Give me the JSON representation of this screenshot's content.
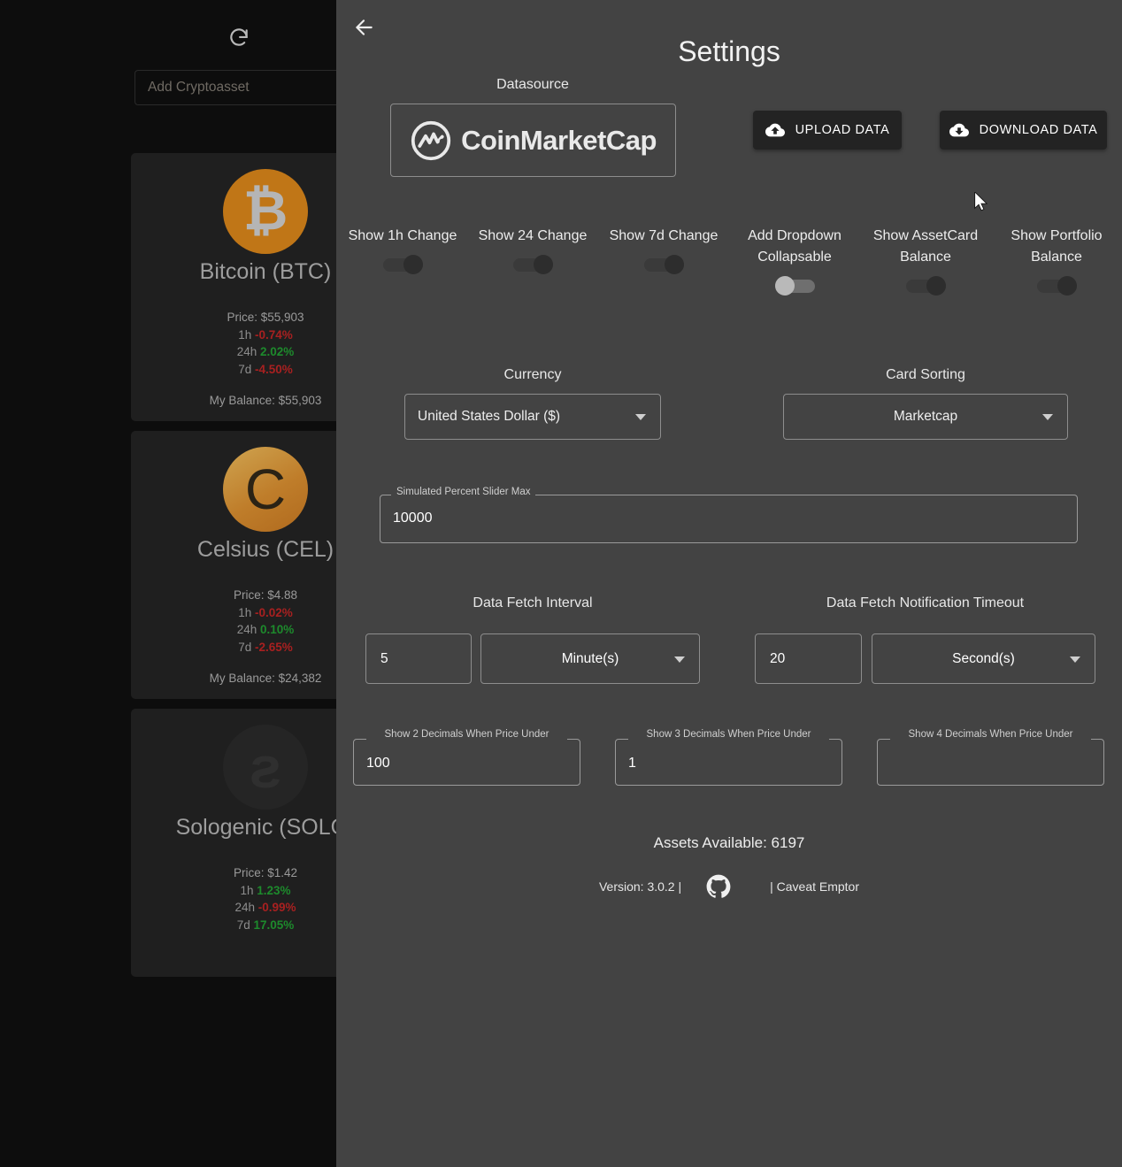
{
  "background_app": {
    "refresh_icon": "refresh-icon",
    "add_asset": {
      "placeholder": "Add Cryptoasset"
    },
    "cards": [
      {
        "glyph": "₿",
        "name": "Bitcoin (BTC)",
        "price_label": "Price: $55,903",
        "change_1h_label": "1h",
        "change_1h": "-0.74%",
        "change_1h_dir": "neg",
        "change_24h_label": "24h",
        "change_24h": "2.02%",
        "change_24h_dir": "pos",
        "change_7d_label": "7d",
        "change_7d": "-4.50%",
        "change_7d_dir": "neg",
        "balance": "My Balance: $55,903"
      },
      {
        "glyph": "C",
        "name": "Celsius (CEL)",
        "price_label": "Price: $4.88",
        "change_1h_label": "1h",
        "change_1h": "-0.02%",
        "change_1h_dir": "neg",
        "change_24h_label": "24h",
        "change_24h": "0.10%",
        "change_24h_dir": "pos",
        "change_7d_label": "7d",
        "change_7d": "-2.65%",
        "change_7d_dir": "neg",
        "balance": "My Balance: $24,382"
      },
      {
        "glyph": "ƨ",
        "name": "Sologenic (SOLO)",
        "price_label": "Price: $1.42",
        "change_1h_label": "1h",
        "change_1h": "1.23%",
        "change_1h_dir": "pos",
        "change_24h_label": "24h",
        "change_24h": "-0.99%",
        "change_24h_dir": "neg",
        "change_7d_label": "7d",
        "change_7d": "17.05%",
        "change_7d_dir": "pos",
        "balance": ""
      }
    ]
  },
  "settings": {
    "title": "Settings",
    "back_icon": "arrow-back-icon",
    "datasource": {
      "label": "Datasource",
      "provider": "CoinMarketCap"
    },
    "upload_button": "UPLOAD DATA",
    "download_button": "DOWNLOAD DATA",
    "toggles": [
      {
        "label": "Show 1h Change",
        "state": "on"
      },
      {
        "label": "Show 24 Change",
        "state": "on"
      },
      {
        "label": "Show 7d Change",
        "state": "on"
      },
      {
        "label": "Add Dropdown Collapsable",
        "state": "off"
      },
      {
        "label": "Show AssetCard Balance",
        "state": "on"
      },
      {
        "label": "Show Portfolio Balance",
        "state": "on"
      }
    ],
    "currency": {
      "label": "Currency",
      "value": "United States Dollar ($)"
    },
    "card_sorting": {
      "label": "Card Sorting",
      "value": "Marketcap"
    },
    "slider_max": {
      "label": "Simulated Percent Slider Max",
      "value": "10000"
    },
    "fetch_interval": {
      "label": "Data Fetch Interval",
      "amount": "5",
      "unit": "Minute(s)"
    },
    "fetch_timeout": {
      "label": "Data Fetch Notification Timeout",
      "amount": "20",
      "unit": "Second(s)"
    },
    "decimals": [
      {
        "label": "Show 2 Decimals When Price Under",
        "value": "100"
      },
      {
        "label": "Show 3 Decimals When Price Under",
        "value": "1"
      },
      {
        "label": "Show 4 Decimals When Price Under",
        "value": ""
      }
    ],
    "assets_available": "Assets Available: 6197",
    "footer": {
      "version": "Version: 3.0.2 |",
      "github_icon": "github-icon",
      "caveat": "| Caveat Emptor"
    }
  },
  "colors": {
    "panel_bg": "#434343",
    "app_bg": "#0d0d0d",
    "card_bg": "#1f1f1f",
    "positive": "#1d8a2c",
    "negative": "#a82020",
    "button_bg": "#232323"
  }
}
